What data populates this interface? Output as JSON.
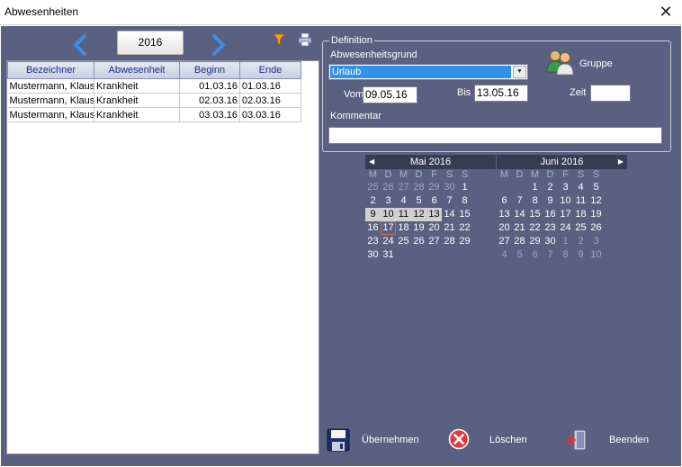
{
  "window": {
    "title": "Abwesenheiten",
    "close_glyph": "✕"
  },
  "year": "2016",
  "grid": {
    "columns": [
      "Bezeichner",
      "Abwesenheit",
      "Beginn",
      "Ende"
    ],
    "rows": [
      [
        "Mustermann, Klaus",
        "Krankheit",
        "01.03.16",
        "01.03.16"
      ],
      [
        "Mustermann, Klaus",
        "Krankheit",
        "02.03.16",
        "02.03.16"
      ],
      [
        "Mustermann, Klaus",
        "Krankheit",
        "03.03.16",
        "03.03.16"
      ]
    ]
  },
  "definition": {
    "legend": "Definition",
    "reason_label": "Abwesenheitsgrund",
    "reason_value": "Urlaub",
    "from_label": "Vom",
    "from_value": "09.05.16",
    "to_label": "Bis",
    "to_value": "13.05.16",
    "time_label": "Zeit",
    "time_value": "",
    "comment_label": "Kommentar",
    "comment_value": "",
    "group_label": "Gruppe"
  },
  "calendar": {
    "day_headers": [
      "M",
      "D",
      "M",
      "D",
      "F",
      "S",
      "S"
    ],
    "months": [
      {
        "title": "Mai 2016",
        "weeks": [
          [
            "25",
            "26",
            "27",
            "28",
            "29",
            "30",
            "1"
          ],
          [
            "2",
            "3",
            "4",
            "5",
            "6",
            "7",
            "8"
          ],
          [
            "9",
            "10",
            "11",
            "12",
            "13",
            "14",
            "15"
          ],
          [
            "16",
            "17",
            "18",
            "19",
            "20",
            "21",
            "22"
          ],
          [
            "23",
            "24",
            "25",
            "26",
            "27",
            "28",
            "29"
          ],
          [
            "30",
            "31",
            "",
            "",
            "",
            "",
            ""
          ]
        ]
      },
      {
        "title": "Juni 2016",
        "weeks": [
          [
            "",
            "",
            "1",
            "2",
            "3",
            "4",
            "5"
          ],
          [
            "6",
            "7",
            "8",
            "9",
            "10",
            "11",
            "12"
          ],
          [
            "13",
            "14",
            "15",
            "16",
            "17",
            "18",
            "19"
          ],
          [
            "20",
            "21",
            "22",
            "23",
            "24",
            "25",
            "26"
          ],
          [
            "27",
            "28",
            "29",
            "30",
            "1",
            "2",
            "3"
          ],
          [
            "4",
            "5",
            "6",
            "7",
            "8",
            "9",
            "10"
          ]
        ]
      }
    ],
    "selected_range": [
      "09.05.16",
      "13.05.16"
    ],
    "today": "17.05.16"
  },
  "buttons": {
    "apply": "Übernehmen",
    "delete": "Löschen",
    "exit": "Beenden"
  },
  "icons": {
    "year_prev": "chevron-left-icon",
    "year_next": "chevron-right-icon",
    "filter": "filter-icon",
    "print": "print-icon",
    "group": "group-icon",
    "apply": "save-icon",
    "delete": "delete-icon",
    "exit": "exit-icon"
  },
  "colors": {
    "background": "#5a6080",
    "accent": "#3390ea",
    "header_text": "#1c2a8a"
  }
}
